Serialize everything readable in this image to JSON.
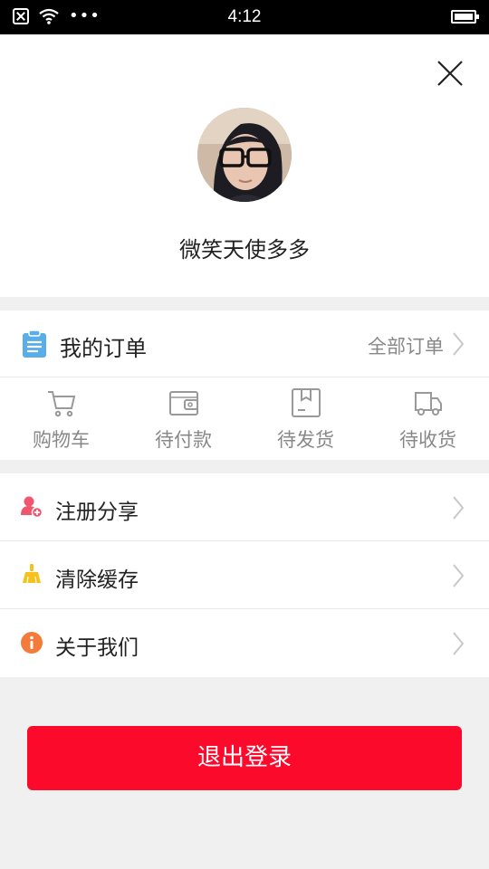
{
  "status_bar": {
    "time": "4:12",
    "dots": "•••"
  },
  "profile": {
    "username": "微笑天使多多"
  },
  "orders": {
    "title": "我的订单",
    "all_label": "全部订单",
    "statuses": [
      {
        "label": "购物车",
        "icon": "cart-icon"
      },
      {
        "label": "待付款",
        "icon": "wallet-icon"
      },
      {
        "label": "待发货",
        "icon": "box-icon"
      },
      {
        "label": "待收货",
        "icon": "truck-icon"
      }
    ]
  },
  "menu": [
    {
      "label": "注册分享",
      "icon": "user-add-icon",
      "color": "#f0566d"
    },
    {
      "label": "清除缓存",
      "icon": "broom-icon",
      "color": "#f6c11a"
    },
    {
      "label": "关于我们",
      "icon": "info-icon",
      "color": "#f57b3b"
    }
  ],
  "logout_label": "退出登录",
  "colors": {
    "accent": "#fb0a2c",
    "order_icon": "#5aaee8"
  }
}
